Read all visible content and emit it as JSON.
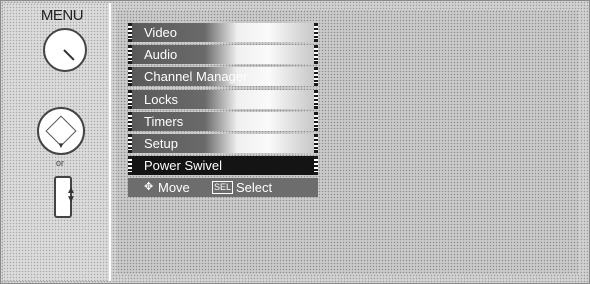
{
  "remote": {
    "menu_label": "MENU",
    "or_label": "or"
  },
  "menu": {
    "items": [
      {
        "label": "Video"
      },
      {
        "label": "Audio"
      },
      {
        "label": "Channel Manager"
      },
      {
        "label": "Locks"
      },
      {
        "label": "Timers"
      },
      {
        "label": "Setup"
      },
      {
        "label": "Power Swivel"
      }
    ],
    "selected_index": 6
  },
  "help_bar": {
    "move_label": "Move",
    "sel_key": "SEL",
    "select_label": "Select"
  }
}
